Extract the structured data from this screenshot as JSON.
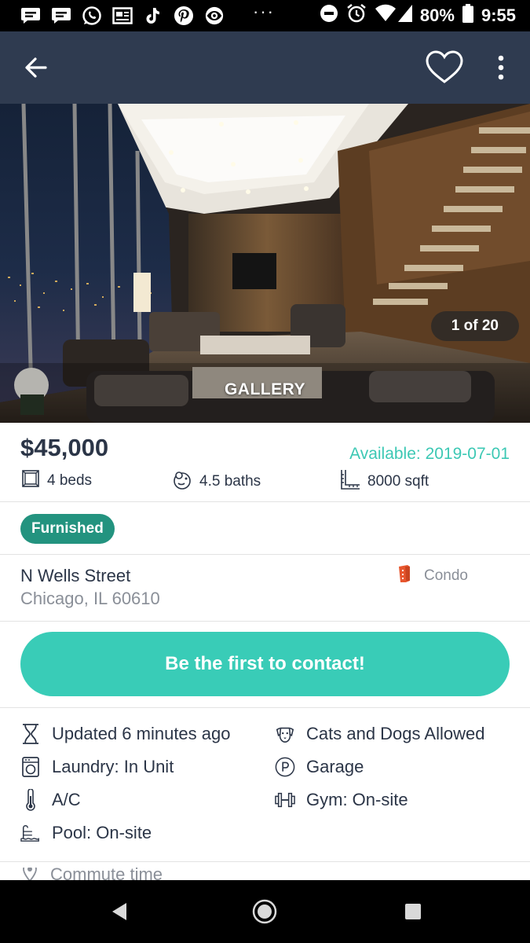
{
  "status_bar": {
    "notification_icons": [
      "message-icon",
      "message-icon",
      "whatsapp-icon",
      "news-icon",
      "tiktok-icon",
      "pinterest-icon",
      "eye-icon"
    ],
    "overflow": "···",
    "battery": "80%",
    "time": "9:55"
  },
  "app_bar": {
    "back_icon": "arrow-left-icon",
    "favorite_icon": "heart-outline-icon",
    "menu_icon": "more-vert-icon"
  },
  "gallery": {
    "counter": "1 of 20",
    "label": "GALLERY"
  },
  "listing": {
    "price": "$45,000",
    "available": "Available: 2019-07-01",
    "beds": "4 beds",
    "baths": "4.5 baths",
    "sqft": "8000 sqft",
    "badge": "Furnished",
    "street": "N Wells Street",
    "city": "Chicago, IL 60610",
    "property_type": "Condo"
  },
  "cta": {
    "label": "Be the first to contact!"
  },
  "features": [
    {
      "label": "Updated 6 minutes ago",
      "icon": "hourglass-icon"
    },
    {
      "label": "Cats and Dogs Allowed",
      "icon": "dog-icon"
    },
    {
      "label": "Laundry: In Unit",
      "icon": "washer-icon"
    },
    {
      "label": "Garage",
      "icon": "parking-icon"
    },
    {
      "label": "A/C",
      "icon": "thermometer-icon"
    },
    {
      "label": "Gym: On-site",
      "icon": "dumbbell-icon"
    },
    {
      "label": "Pool: On-site",
      "icon": "pool-ladder-icon"
    }
  ],
  "commute": {
    "label": "Commute time"
  },
  "colors": {
    "app_bar": "#2f3b50",
    "accent": "#39ccb7",
    "badge": "#23937f",
    "available_text": "#3cc8b4",
    "text": "#2b3547",
    "muted": "#8a8f98"
  }
}
